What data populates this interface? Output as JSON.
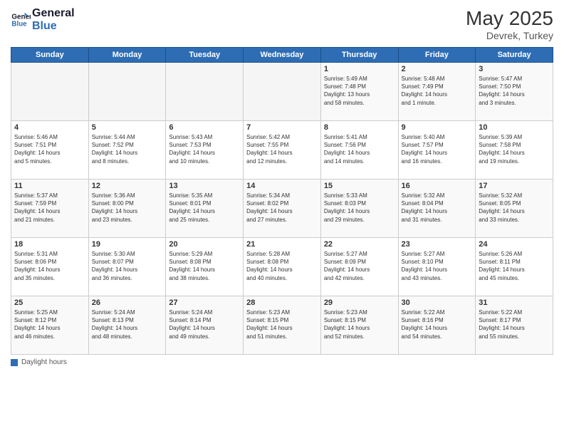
{
  "logo": {
    "line1": "General",
    "line2": "Blue"
  },
  "title": {
    "month_year": "May 2025",
    "location": "Devrek, Turkey"
  },
  "header_days": [
    "Sunday",
    "Monday",
    "Tuesday",
    "Wednesday",
    "Thursday",
    "Friday",
    "Saturday"
  ],
  "weeks": [
    [
      {
        "day": "",
        "info": ""
      },
      {
        "day": "",
        "info": ""
      },
      {
        "day": "",
        "info": ""
      },
      {
        "day": "",
        "info": ""
      },
      {
        "day": "1",
        "info": "Sunrise: 5:49 AM\nSunset: 7:48 PM\nDaylight: 13 hours\nand 58 minutes."
      },
      {
        "day": "2",
        "info": "Sunrise: 5:48 AM\nSunset: 7:49 PM\nDaylight: 14 hours\nand 1 minute."
      },
      {
        "day": "3",
        "info": "Sunrise: 5:47 AM\nSunset: 7:50 PM\nDaylight: 14 hours\nand 3 minutes."
      }
    ],
    [
      {
        "day": "4",
        "info": "Sunrise: 5:46 AM\nSunset: 7:51 PM\nDaylight: 14 hours\nand 5 minutes."
      },
      {
        "day": "5",
        "info": "Sunrise: 5:44 AM\nSunset: 7:52 PM\nDaylight: 14 hours\nand 8 minutes."
      },
      {
        "day": "6",
        "info": "Sunrise: 5:43 AM\nSunset: 7:53 PM\nDaylight: 14 hours\nand 10 minutes."
      },
      {
        "day": "7",
        "info": "Sunrise: 5:42 AM\nSunset: 7:55 PM\nDaylight: 14 hours\nand 12 minutes."
      },
      {
        "day": "8",
        "info": "Sunrise: 5:41 AM\nSunset: 7:56 PM\nDaylight: 14 hours\nand 14 minutes."
      },
      {
        "day": "9",
        "info": "Sunrise: 5:40 AM\nSunset: 7:57 PM\nDaylight: 14 hours\nand 16 minutes."
      },
      {
        "day": "10",
        "info": "Sunrise: 5:39 AM\nSunset: 7:58 PM\nDaylight: 14 hours\nand 19 minutes."
      }
    ],
    [
      {
        "day": "11",
        "info": "Sunrise: 5:37 AM\nSunset: 7:59 PM\nDaylight: 14 hours\nand 21 minutes."
      },
      {
        "day": "12",
        "info": "Sunrise: 5:36 AM\nSunset: 8:00 PM\nDaylight: 14 hours\nand 23 minutes."
      },
      {
        "day": "13",
        "info": "Sunrise: 5:35 AM\nSunset: 8:01 PM\nDaylight: 14 hours\nand 25 minutes."
      },
      {
        "day": "14",
        "info": "Sunrise: 5:34 AM\nSunset: 8:02 PM\nDaylight: 14 hours\nand 27 minutes."
      },
      {
        "day": "15",
        "info": "Sunrise: 5:33 AM\nSunset: 8:03 PM\nDaylight: 14 hours\nand 29 minutes."
      },
      {
        "day": "16",
        "info": "Sunrise: 5:32 AM\nSunset: 8:04 PM\nDaylight: 14 hours\nand 31 minutes."
      },
      {
        "day": "17",
        "info": "Sunrise: 5:32 AM\nSunset: 8:05 PM\nDaylight: 14 hours\nand 33 minutes."
      }
    ],
    [
      {
        "day": "18",
        "info": "Sunrise: 5:31 AM\nSunset: 8:06 PM\nDaylight: 14 hours\nand 35 minutes."
      },
      {
        "day": "19",
        "info": "Sunrise: 5:30 AM\nSunset: 8:07 PM\nDaylight: 14 hours\nand 36 minutes."
      },
      {
        "day": "20",
        "info": "Sunrise: 5:29 AM\nSunset: 8:08 PM\nDaylight: 14 hours\nand 38 minutes."
      },
      {
        "day": "21",
        "info": "Sunrise: 5:28 AM\nSunset: 8:08 PM\nDaylight: 14 hours\nand 40 minutes."
      },
      {
        "day": "22",
        "info": "Sunrise: 5:27 AM\nSunset: 8:09 PM\nDaylight: 14 hours\nand 42 minutes."
      },
      {
        "day": "23",
        "info": "Sunrise: 5:27 AM\nSunset: 8:10 PM\nDaylight: 14 hours\nand 43 minutes."
      },
      {
        "day": "24",
        "info": "Sunrise: 5:26 AM\nSunset: 8:11 PM\nDaylight: 14 hours\nand 45 minutes."
      }
    ],
    [
      {
        "day": "25",
        "info": "Sunrise: 5:25 AM\nSunset: 8:12 PM\nDaylight: 14 hours\nand 46 minutes."
      },
      {
        "day": "26",
        "info": "Sunrise: 5:24 AM\nSunset: 8:13 PM\nDaylight: 14 hours\nand 48 minutes."
      },
      {
        "day": "27",
        "info": "Sunrise: 5:24 AM\nSunset: 8:14 PM\nDaylight: 14 hours\nand 49 minutes."
      },
      {
        "day": "28",
        "info": "Sunrise: 5:23 AM\nSunset: 8:15 PM\nDaylight: 14 hours\nand 51 minutes."
      },
      {
        "day": "29",
        "info": "Sunrise: 5:23 AM\nSunset: 8:15 PM\nDaylight: 14 hours\nand 52 minutes."
      },
      {
        "day": "30",
        "info": "Sunrise: 5:22 AM\nSunset: 8:16 PM\nDaylight: 14 hours\nand 54 minutes."
      },
      {
        "day": "31",
        "info": "Sunrise: 5:22 AM\nSunset: 8:17 PM\nDaylight: 14 hours\nand 55 minutes."
      }
    ]
  ],
  "footer": {
    "label": "Daylight hours"
  }
}
